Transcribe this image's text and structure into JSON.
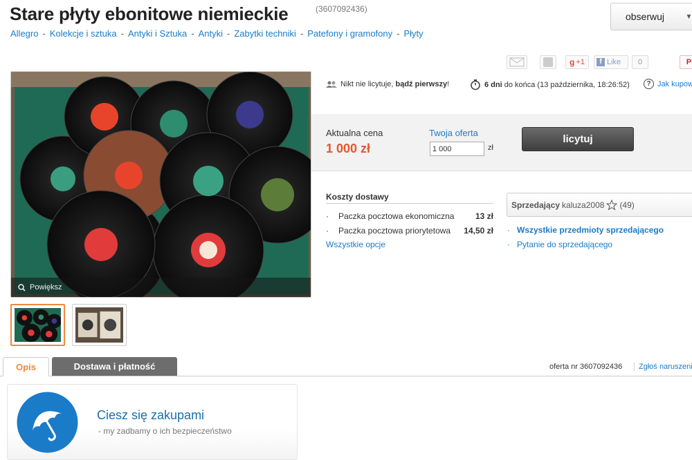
{
  "header": {
    "title": "Stare płyty ebonitowe niemieckie",
    "item_id": "(3607092436)",
    "watch_label": "obserwuj"
  },
  "breadcrumb": [
    "Allegro",
    "Kolekcje i sztuka",
    "Antyki i Sztuka",
    "Antyki",
    "Zabytki techniki",
    "Patefony i gramofony",
    "Płyty"
  ],
  "social": {
    "gplus": "+1",
    "like": "Like",
    "like_count": "0",
    "pinterest": "Pi"
  },
  "gallery": {
    "zoom_label": "Powiększ"
  },
  "auction": {
    "bids_prefix": "Nikt nie licytuje,",
    "bids_bold": "bądź pierwszy",
    "bids_suffix": "!",
    "days_bold": "6 dni",
    "time_rest": "do końca (13 października, 18:26:52)",
    "how_buy": "Jak kupow"
  },
  "price": {
    "label": "Aktualna cena",
    "value": "1 000 zł",
    "offer_label": "Twoja oferta",
    "offer_value": "1 000",
    "offer_unit": "zł",
    "bid_button": "licytuj"
  },
  "shipping": {
    "title": "Koszty dostawy",
    "rows": [
      {
        "name": "Paczka pocztowa ekonomiczna",
        "value": "13 zł"
      },
      {
        "name": "Paczka pocztowa priorytetowa",
        "value": "14,50 zł"
      }
    ],
    "all_options": "Wszystkie opcje"
  },
  "seller": {
    "label": "Sprzedający",
    "name": "kaluza2008",
    "rating": "(49)",
    "all_items": "Wszystkie przedmioty sprzedającego",
    "ask": "Pytanie do sprzedającego"
  },
  "tabs": {
    "description": "Opis",
    "delivery": "Dostawa i płatność",
    "offer_no": "oferta nr 3607092436",
    "report": "Zgłoś naruszenie"
  },
  "promo": {
    "title": "Ciesz się zakupami",
    "subtitle": "- my zadbamy o ich bezpieczeństwo"
  },
  "colors": {
    "link": "#1a7bc8",
    "price": "#e4572e",
    "accent": "#f0893a",
    "promo_blue": "#1a7bc8"
  }
}
